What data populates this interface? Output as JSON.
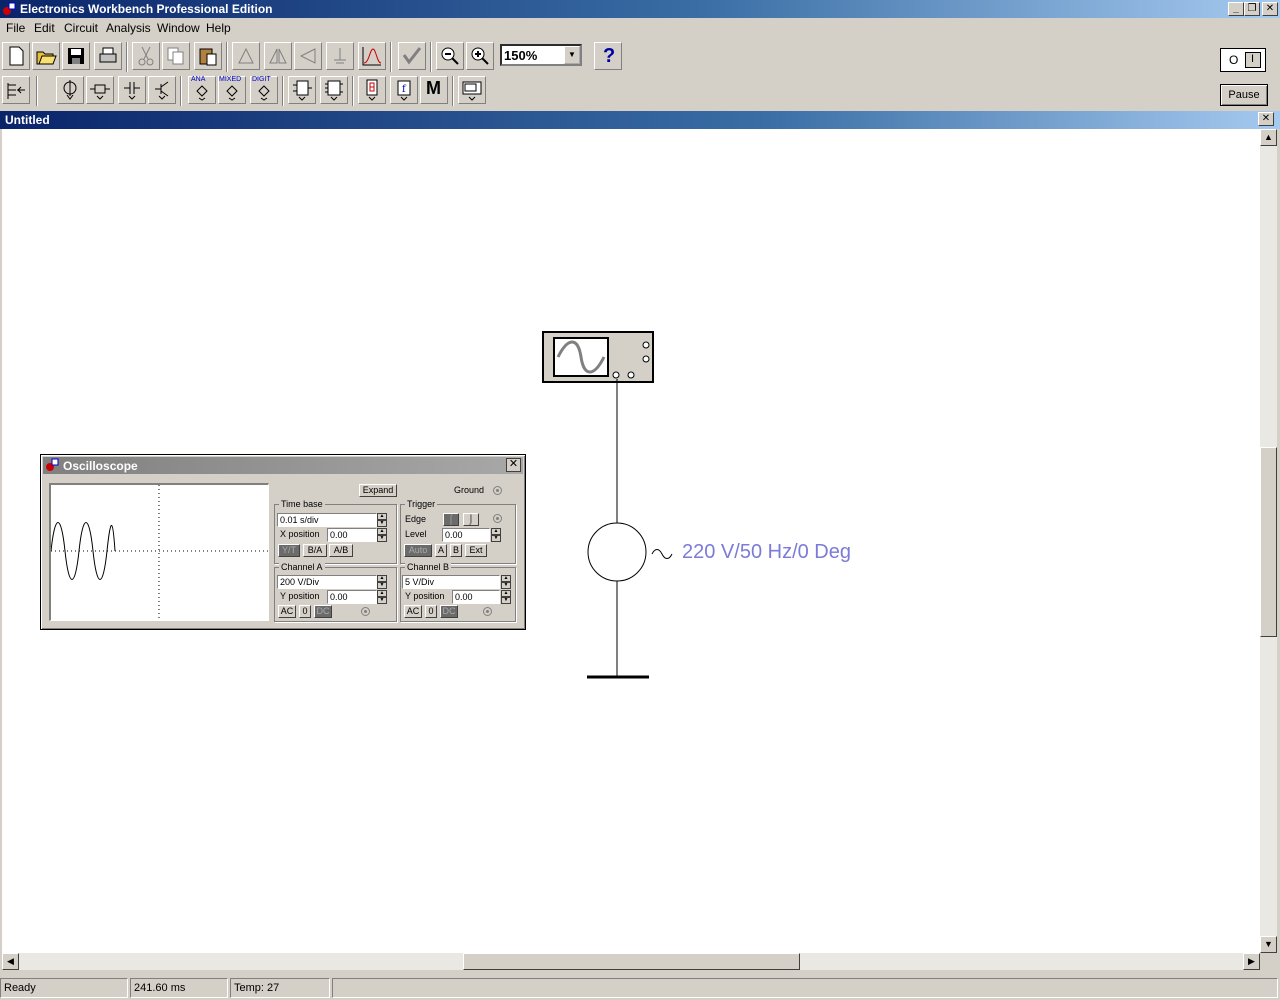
{
  "app": {
    "title": "Electronics Workbench Professional Edition",
    "icon": "ewb-app-icon"
  },
  "menu": [
    {
      "label": "File"
    },
    {
      "label": "Edit"
    },
    {
      "label": "Circuit"
    },
    {
      "label": "Analysis"
    },
    {
      "label": "Window"
    },
    {
      "label": "Help"
    }
  ],
  "toolbar": {
    "zoom_value": "150%",
    "help_glyph": "?",
    "pause_label": "Pause",
    "power_switch": {
      "off": "O",
      "on": "I"
    },
    "bins_labels": {
      "analog": "ANA",
      "mixed": "MIXED",
      "digital": "DIGIT",
      "misc": "M"
    }
  },
  "document": {
    "title": "Untitled"
  },
  "circuit": {
    "source_label": "220 V/50 Hz/0 Deg",
    "colors": {
      "label": "#7b7bd8",
      "wire": "#000000"
    }
  },
  "oscilloscope": {
    "title": "Oscilloscope",
    "expand_label": "Expand",
    "ground_label": "Ground",
    "time_base": {
      "title": "Time base",
      "value": "0.01 s/div",
      "x_position_label": "X position",
      "x_position": "0.00",
      "modes": [
        "Y/T",
        "B/A",
        "A/B"
      ]
    },
    "trigger": {
      "title": "Trigger",
      "edge_label": "Edge",
      "level_label": "Level",
      "level": "0.00",
      "modes": [
        "Auto",
        "A",
        "B",
        "Ext"
      ]
    },
    "channel_a": {
      "title": "Channel A",
      "value": "200  V/Div",
      "y_position_label": "Y position",
      "y_position": "0.00",
      "coupling": [
        "AC",
        "0",
        "DC"
      ]
    },
    "channel_b": {
      "title": "Channel B",
      "value": " 5  V/Div",
      "y_position_label": "Y position",
      "y_position": "0.00",
      "coupling": [
        "AC",
        "0",
        "DC"
      ]
    }
  },
  "status": {
    "state": "Ready",
    "time": "241.60 ms",
    "temp": "Temp:  27"
  }
}
